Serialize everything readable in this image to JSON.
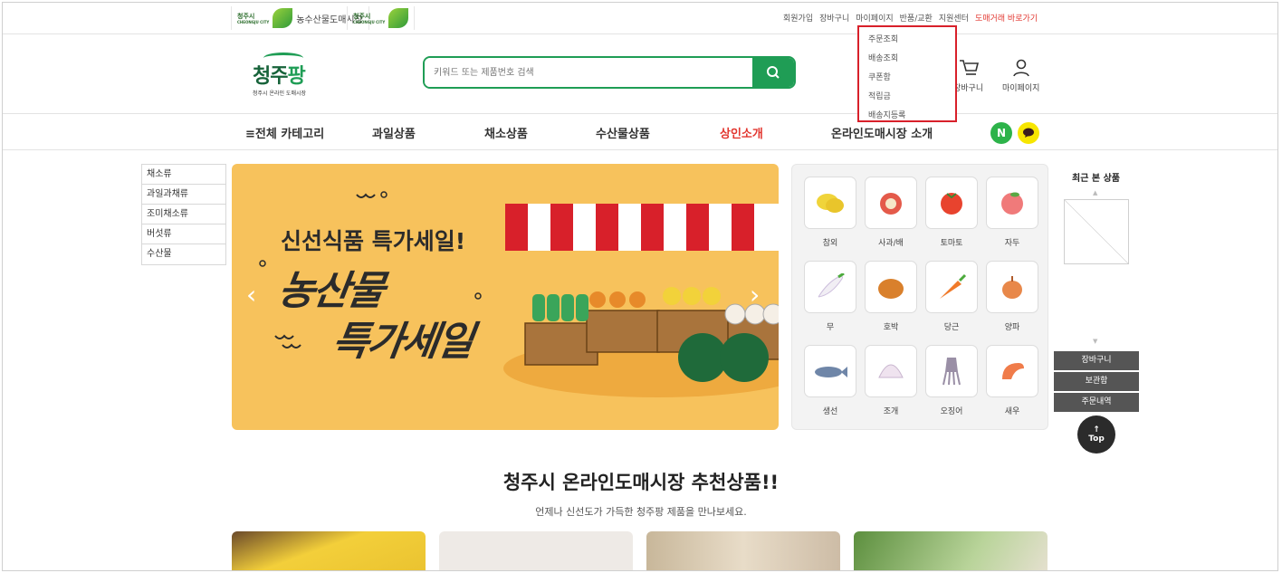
{
  "topbar": {
    "logo1_city": "청주시",
    "logo1_city_en": "CHEONGJU CITY",
    "logo1_name": "농수산물도매시장",
    "logo2_city": "청주시",
    "logo2_city_en": "CHEONGJU CITY",
    "links": [
      {
        "label": "회원가입"
      },
      {
        "label": "장바구니"
      },
      {
        "label": "마이페이지"
      },
      {
        "label": "반품/교환"
      },
      {
        "label": "지원센터"
      },
      {
        "label": "도매거래 바로가기"
      }
    ]
  },
  "mypage_dropdown": [
    "주문조회",
    "배송조회",
    "쿠폰함",
    "적립금",
    "배송지등록"
  ],
  "header": {
    "logo_text_a": "청주",
    "logo_text_b": "팡",
    "logo_sub": "청주시 온라인 도매시장",
    "search_placeholder": "키워드 또는 제품번호 검색",
    "icon_search": "search-icon",
    "cart_label": "장바구니",
    "mypage_label": "마이페이지"
  },
  "nav": {
    "all_categories": "≡전체 카테고리",
    "items": [
      "과일상품",
      "채소상품",
      "수산물상품",
      "상인소개",
      "온라인도매시장 소개"
    ],
    "highlight_color": "#e2362f",
    "naver_label": "N"
  },
  "left_categories": [
    "채소류",
    "과일과채류",
    "조미채소류",
    "버섯류",
    "수산물"
  ],
  "banner": {
    "headline": "신선식품 특가세일!",
    "big_line1": "농산물",
    "big_line2": "특가세일",
    "bg_color": "#f7c25c"
  },
  "produce": [
    {
      "label": "참외",
      "icon": "korean-melon-icon"
    },
    {
      "label": "사과/배",
      "icon": "apple-icon"
    },
    {
      "label": "토마토",
      "icon": "tomato-icon"
    },
    {
      "label": "자두",
      "icon": "plum-icon"
    },
    {
      "label": "무",
      "icon": "radish-icon"
    },
    {
      "label": "호박",
      "icon": "pumpkin-icon"
    },
    {
      "label": "당근",
      "icon": "carrot-icon"
    },
    {
      "label": "양파",
      "icon": "onion-icon"
    },
    {
      "label": "생선",
      "icon": "fish-icon"
    },
    {
      "label": "조개",
      "icon": "clam-icon"
    },
    {
      "label": "오징어",
      "icon": "squid-icon"
    },
    {
      "label": "새우",
      "icon": "shrimp-icon"
    }
  ],
  "recent": {
    "title": "최근 본 상품",
    "buttons": [
      "장바구니",
      "보관함",
      "주문내역"
    ],
    "top_label": "Top"
  },
  "recommend": {
    "title": "청주시 온라인도매시장 추천상품!!",
    "subtitle": "언제나 신선도가 가득한 청주팡 제품을 만나보세요."
  },
  "colors": {
    "brand": "#1f9d55",
    "accent": "#e2362f",
    "highlight_box": "#d8202a"
  }
}
